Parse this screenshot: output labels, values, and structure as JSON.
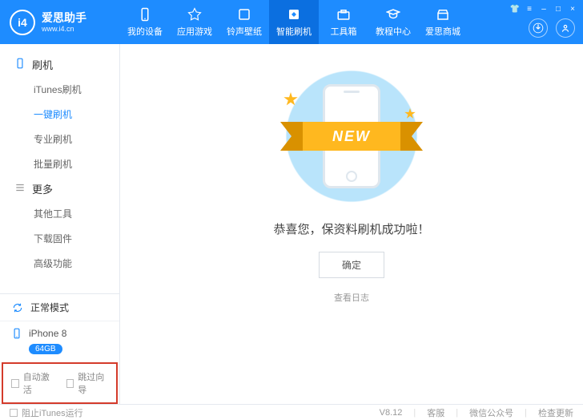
{
  "header": {
    "brand": "爱思助手",
    "url": "www.i4.cn",
    "nav": [
      {
        "label": "我的设备"
      },
      {
        "label": "应用游戏"
      },
      {
        "label": "铃声壁纸"
      },
      {
        "label": "智能刷机"
      },
      {
        "label": "工具箱"
      },
      {
        "label": "教程中心"
      },
      {
        "label": "爱思商城"
      }
    ]
  },
  "sidebar": {
    "group1": {
      "title": "刷机",
      "items": [
        "iTunes刷机",
        "一键刷机",
        "专业刷机",
        "批量刷机"
      ]
    },
    "group2": {
      "title": "更多",
      "items": [
        "其他工具",
        "下载固件",
        "高级功能"
      ]
    },
    "mode": "正常模式",
    "device": {
      "name": "iPhone 8",
      "storage": "64GB"
    },
    "auto_activate": "自动激活",
    "skip_guide": "跳过向导"
  },
  "content": {
    "ribbon": "NEW",
    "message": "恭喜您，保资料刷机成功啦！",
    "confirm": "确定",
    "log_link": "查看日志"
  },
  "footer": {
    "block_itunes": "阻止iTunes运行",
    "version": "V8.12",
    "support": "客服",
    "wechat": "微信公众号",
    "update": "检查更新"
  }
}
